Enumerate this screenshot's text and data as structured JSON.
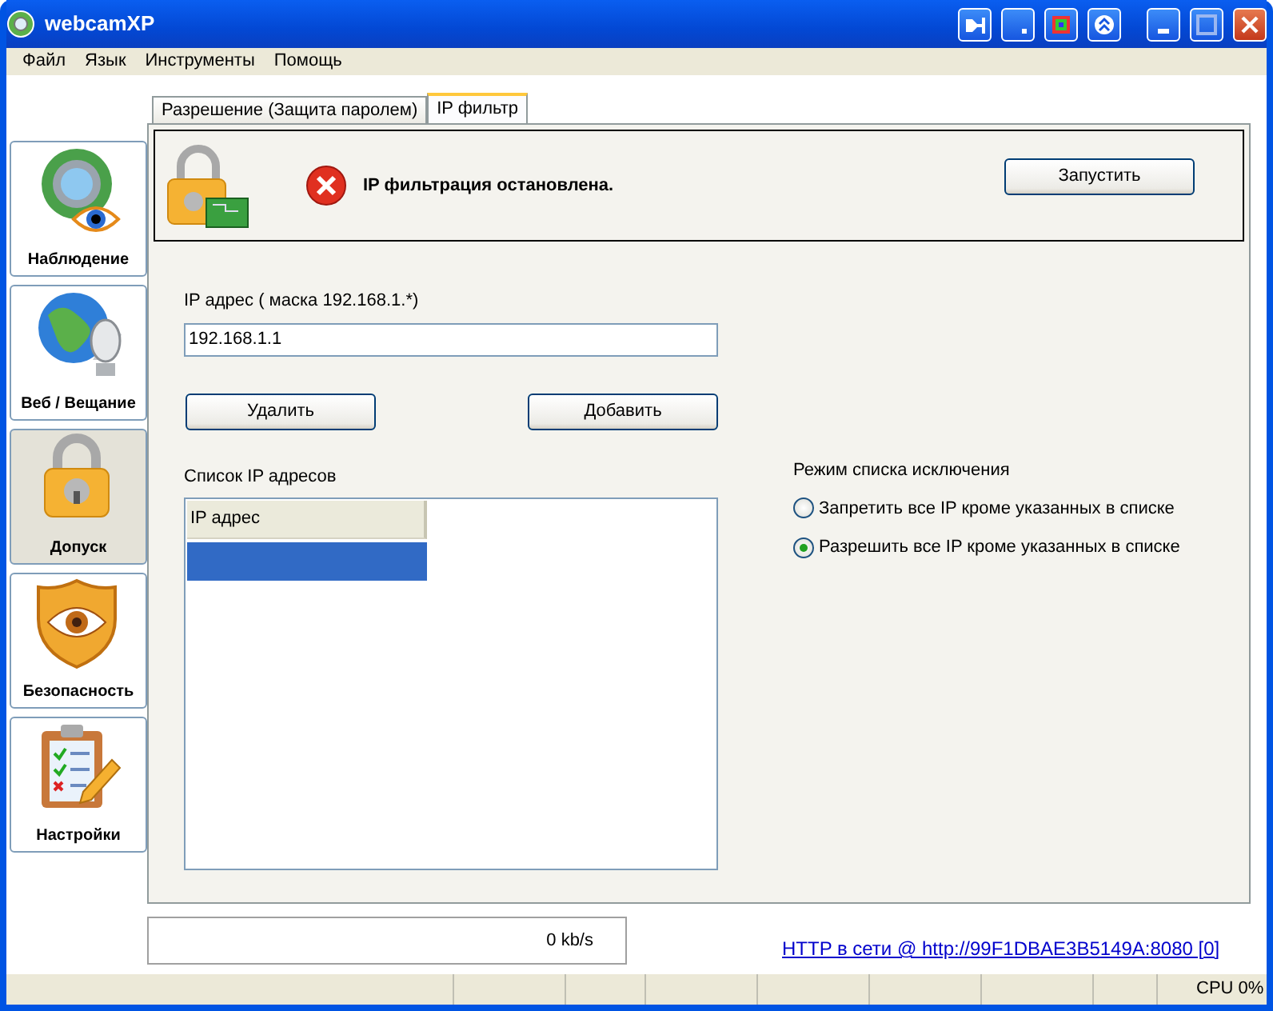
{
  "window": {
    "title": "webcamXP"
  },
  "menu": [
    "Файл",
    "Язык",
    "Инструменты",
    "Помощь"
  ],
  "sidebar": {
    "items": [
      {
        "label": "Наблюдение",
        "kind": "webcam",
        "selected": false
      },
      {
        "label": "Веб / Вещание",
        "kind": "globe",
        "selected": false
      },
      {
        "label": "Допуск",
        "kind": "lock",
        "selected": true
      },
      {
        "label": "Безопасность",
        "kind": "shield",
        "selected": false
      },
      {
        "label": "Настройки",
        "kind": "clipboard",
        "selected": false
      }
    ]
  },
  "tabs": [
    {
      "label": "Разрешение (Защита паролем)",
      "selected": false
    },
    {
      "label": "IP фильтр",
      "selected": true
    }
  ],
  "banner": {
    "message": "IP фильтрация остановлена.",
    "button": "Запустить"
  },
  "ip_field": {
    "label": "IP адрес ( маска 192.168.1.*)",
    "value": "192.168.1.1"
  },
  "buttons": [
    "Удалить",
    "Добавить"
  ],
  "ip_list": {
    "label": "Список IP адресов",
    "columns": [
      "IP адрес"
    ],
    "rows": [
      {
        "selected": true
      }
    ]
  },
  "mode": {
    "label": "Режим списка исключения",
    "options": [
      {
        "label": "Запретить все IP кроме указанных в списке",
        "selected": false
      },
      {
        "label": "Разрешить все IP кроме указанных в списке",
        "selected": true
      }
    ]
  },
  "speed": "0 kb/s",
  "http_link": "HTTP в сети @ http://99F1DBAE3B5149A:8080 [0]",
  "status_bar": {
    "cpu": "CPU 0%"
  }
}
